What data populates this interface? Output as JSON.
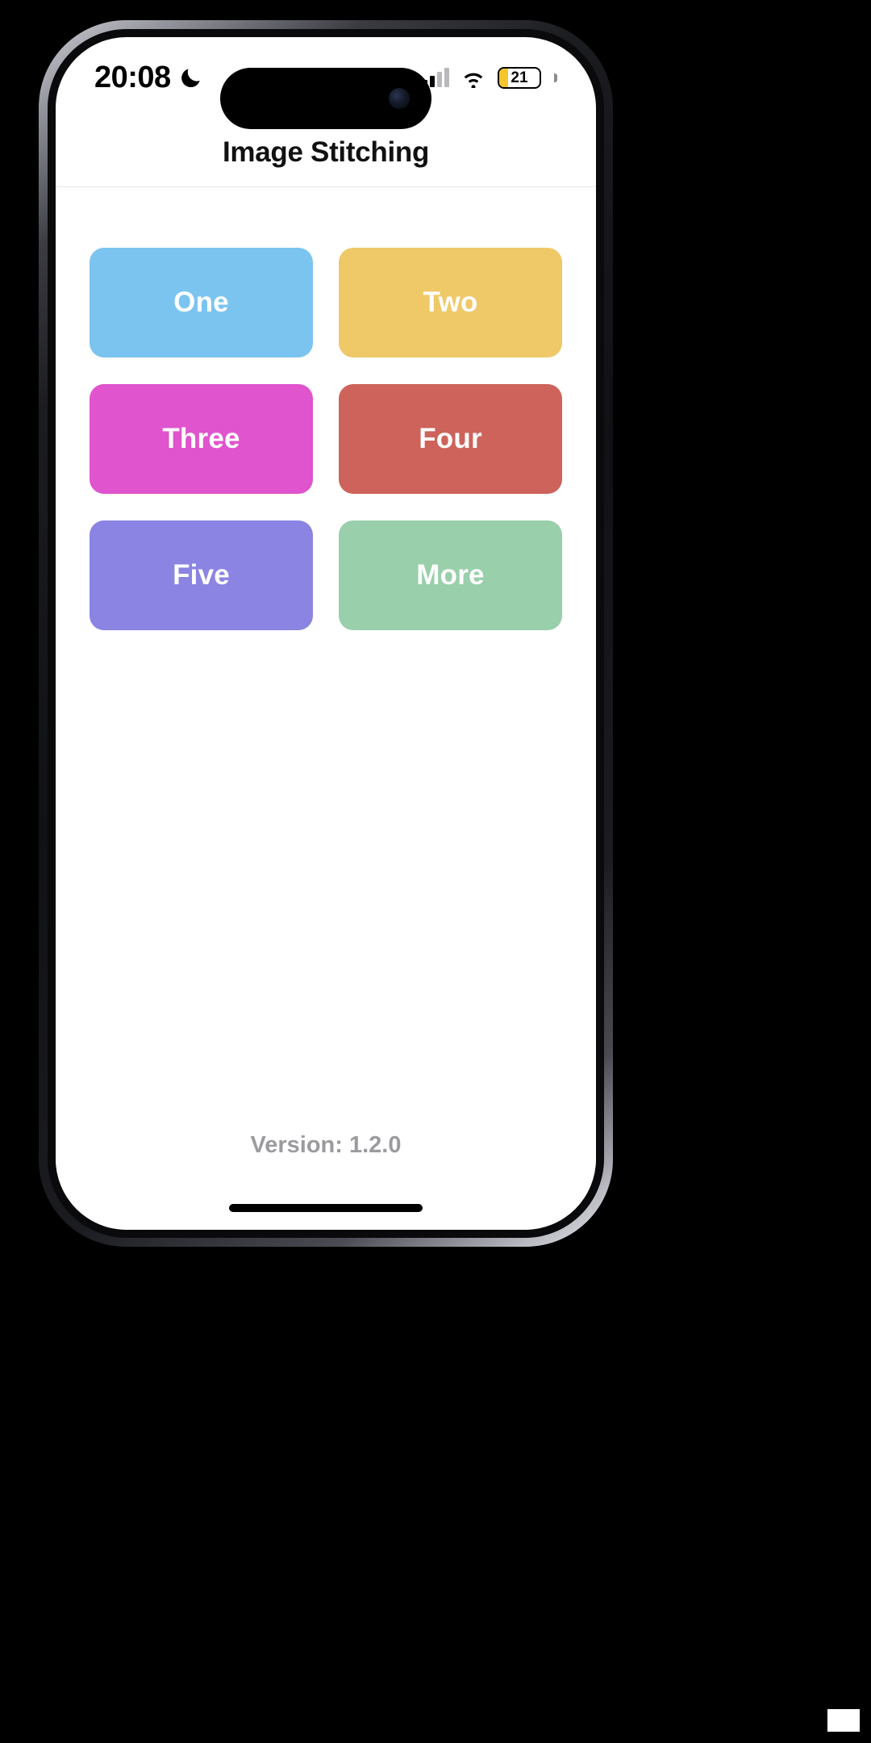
{
  "status_bar": {
    "time": "20:08",
    "dnd_icon": "crescent-moon-icon",
    "cellular_icon": "cellular-signal-icon",
    "wifi_icon": "wifi-icon",
    "battery_level": "21",
    "battery_color": "#f5c52b"
  },
  "app_bar": {
    "title": "Image Stitching"
  },
  "grid": {
    "tiles": [
      {
        "label": "One",
        "color": "#7cc4f0"
      },
      {
        "label": "Two",
        "color": "#efc868"
      },
      {
        "label": "Three",
        "color": "#e054cd"
      },
      {
        "label": "Four",
        "color": "#cd635b"
      },
      {
        "label": "Five",
        "color": "#8b84e2"
      },
      {
        "label": "More",
        "color": "#99cfab"
      }
    ]
  },
  "footer": {
    "version": "Version: 1.2.0"
  }
}
